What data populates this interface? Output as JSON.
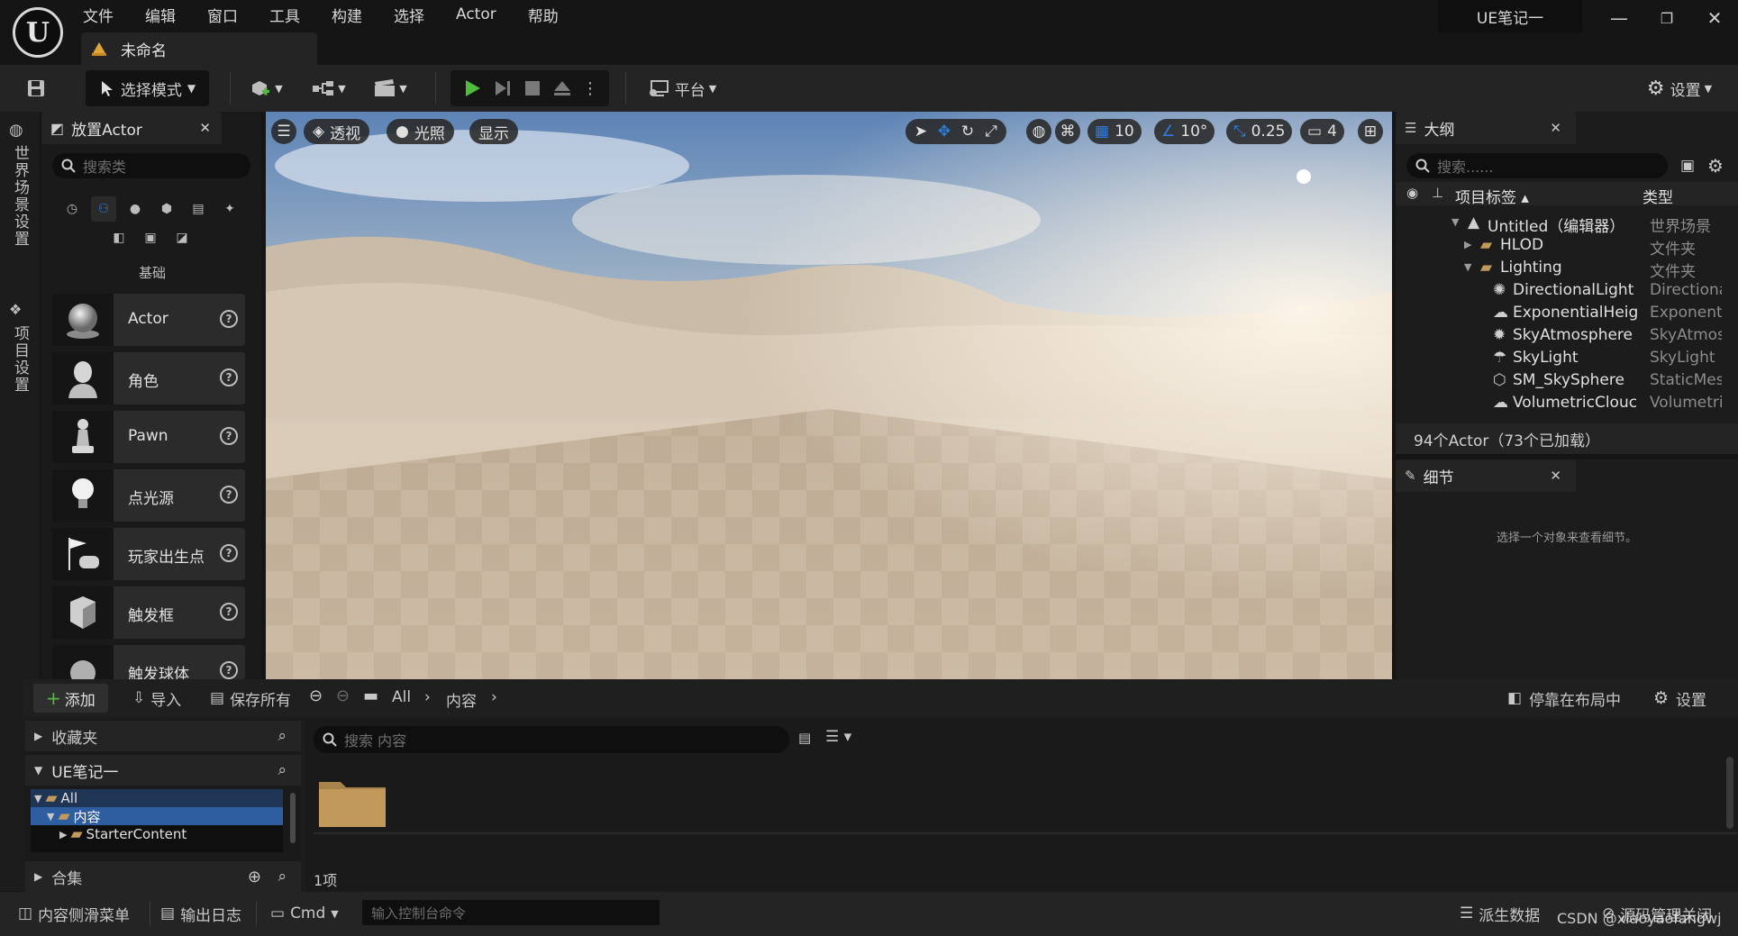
{
  "window": {
    "app_title": "UE笔记一",
    "doc_tab": "未命名",
    "controls": [
      "—",
      "❐",
      "✕"
    ]
  },
  "menu": [
    "文件",
    "编辑",
    "窗口",
    "工具",
    "构建",
    "选择",
    "Actor",
    "帮助"
  ],
  "toolbar": {
    "select_mode": "选择模式",
    "platform": "平台",
    "settings": "设置"
  },
  "left_strip": {
    "world_settings": "世界场景设置",
    "project_settings": "项目设置"
  },
  "place_actor": {
    "title": "放置Actor",
    "search_placeholder": "搜索类",
    "category": "基础",
    "items": [
      {
        "label": "Actor",
        "icon": "sphere-icon"
      },
      {
        "label": "角色",
        "icon": "character-icon"
      },
      {
        "label": "Pawn",
        "icon": "pawn-icon"
      },
      {
        "label": "点光源",
        "icon": "lightbulb-icon"
      },
      {
        "label": "玩家出生点",
        "icon": "player-start-icon"
      },
      {
        "label": "触发框",
        "icon": "trigger-box-icon"
      },
      {
        "label": "触发球体",
        "icon": "trigger-sphere-icon"
      }
    ]
  },
  "viewport": {
    "perspective": "透视",
    "lighting": "光照",
    "show": "显示",
    "grid_snap": "10",
    "rot_snap": "10°",
    "scale_snap": "0.25",
    "camera_speed": "4"
  },
  "outliner": {
    "title": "大纲",
    "search_placeholder": "搜索......",
    "col_label": "项目标签",
    "col_type": "类型",
    "rows": [
      {
        "label": "Untitled（编辑器）",
        "type": "世界场景",
        "indent": 0,
        "icon": "level-icon",
        "expanded": true
      },
      {
        "label": "HLOD",
        "type": "文件夹",
        "indent": 1,
        "icon": "folder-icon",
        "expanded": false
      },
      {
        "label": "Lighting",
        "type": "文件夹",
        "indent": 1,
        "icon": "folder-open-icon",
        "expanded": true
      },
      {
        "label": "DirectionalLight",
        "type": "Directiona",
        "indent": 2,
        "icon": "sun-icon"
      },
      {
        "label": "ExponentialHeig",
        "type": "Exponent",
        "indent": 2,
        "icon": "fog-icon"
      },
      {
        "label": "SkyAtmosphere",
        "type": "SkyAtmos",
        "indent": 2,
        "icon": "atmosphere-icon"
      },
      {
        "label": "SkyLight",
        "type": "SkyLight",
        "indent": 2,
        "icon": "skylight-icon"
      },
      {
        "label": "SM_SkySphere",
        "type": "StaticMes",
        "indent": 2,
        "icon": "mesh-icon"
      },
      {
        "label": "VolumetricClouc",
        "type": "Volumetri",
        "indent": 2,
        "icon": "cloud-icon"
      }
    ],
    "footer": "94个Actor（73个已加载）"
  },
  "details": {
    "title": "细节",
    "empty_text": "选择一个对象来查看细节。"
  },
  "content_browser": {
    "add": "添加",
    "import": "导入",
    "save_all": "保存所有",
    "path_all": "All",
    "path_content": "内容",
    "dock": "停靠在布局中",
    "settings": "设置",
    "favorites": "收藏夹",
    "project": "UE笔记一",
    "tree": [
      {
        "label": "All",
        "indent": 0
      },
      {
        "label": "内容",
        "indent": 1
      },
      {
        "label": "StarterContent",
        "indent": 2
      }
    ],
    "collections": "合集",
    "search_placeholder": "搜索 内容",
    "item_count": "1项"
  },
  "statusbar": {
    "content_drawer": "内容侧滑菜单",
    "output_log": "输出日志",
    "cmd": "Cmd",
    "console_placeholder": "输入控制台命令",
    "derived_data": "派生数据",
    "source_control": "源码管理关闭",
    "watermark": "CSDN @xiaoyaofangwj"
  },
  "colors": {
    "accent_blue": "#1b6ad3",
    "play_green": "#4fbc3c",
    "selection": "#2f5ea0",
    "folder": "#c19a5b"
  }
}
